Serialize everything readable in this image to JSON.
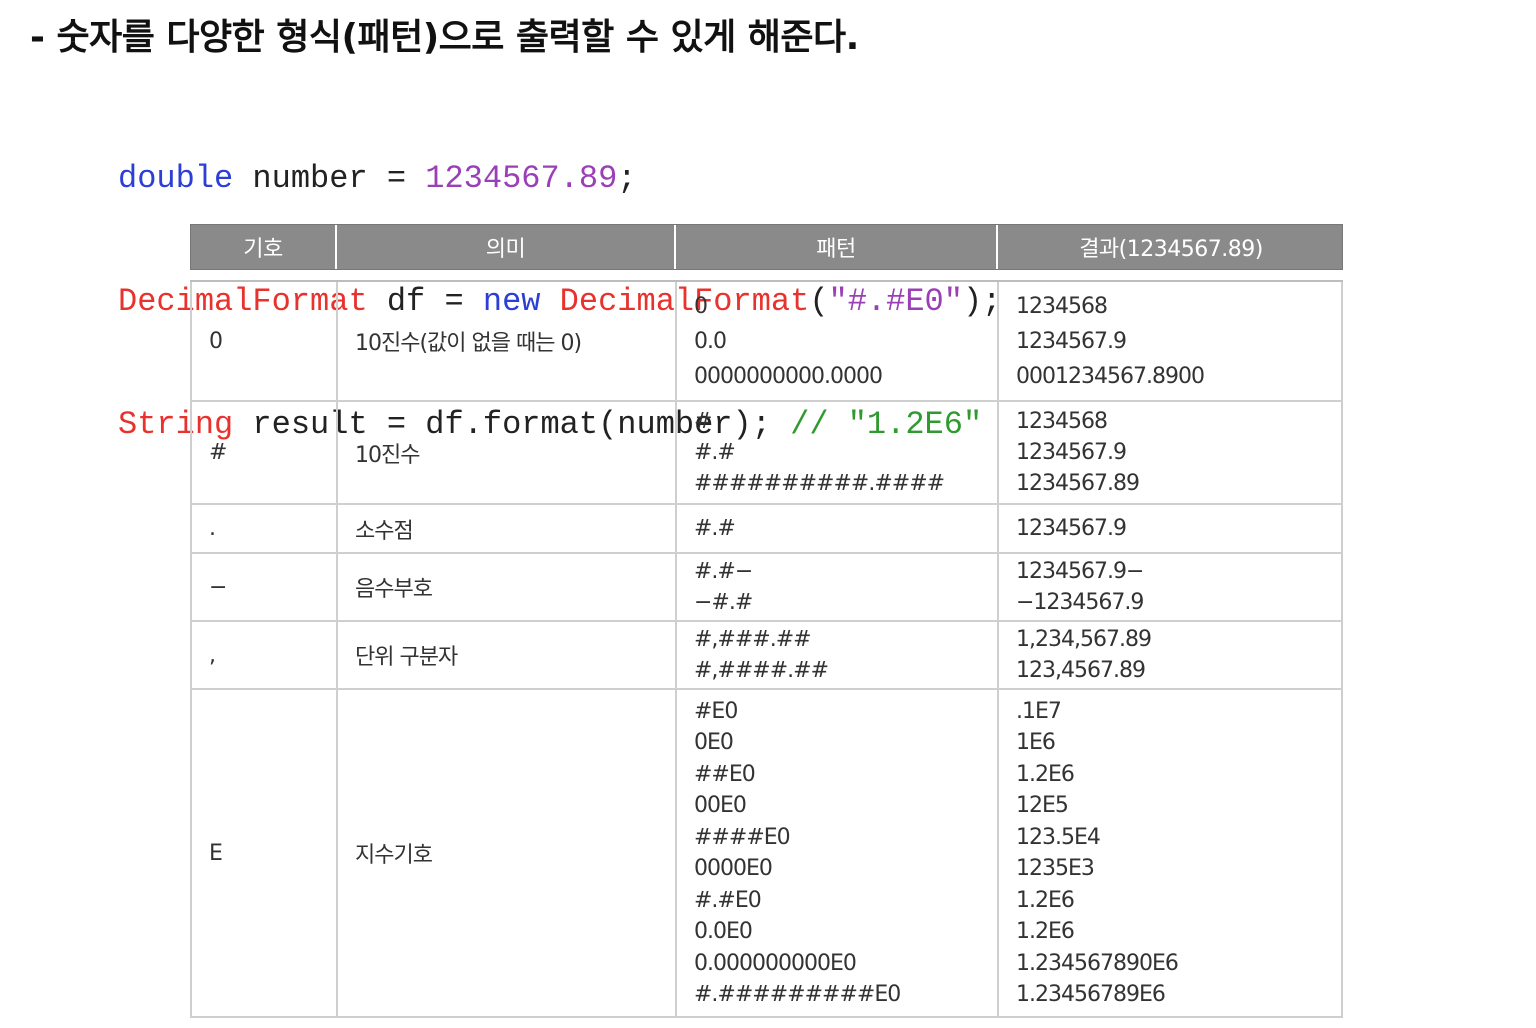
{
  "heading": "- 숫자를 다양한 형식(패턴)으로 출력할 수 있게 해준다.",
  "code": {
    "line1": {
      "type": "double",
      "rest": " number = ",
      "value": "1234567.89",
      "end": ";"
    },
    "line2": {
      "cls": "DecimalFormat",
      "mid": " df = ",
      "kw": "new",
      "ctor": " DecimalFormat",
      "open": "(",
      "arg": "\"#.#E0\"",
      "close": ");"
    },
    "line3": {
      "type": "String",
      "rest": " result = df.format(number); ",
      "comment": "// ",
      "cmt_str": "\"1.2E6\""
    }
  },
  "table": {
    "headers": [
      "기호",
      "의미",
      "패턴",
      "결과(1234567.89)"
    ],
    "rows": [
      {
        "symbol": "0",
        "meaning": "10진수(값이 없을 때는 0)",
        "patterns": [
          "0",
          "0.0",
          "0000000000.0000"
        ],
        "results": [
          "1234568",
          "1234567.9",
          "0001234567.8900"
        ]
      },
      {
        "symbol": "#",
        "meaning": "10진수",
        "patterns": [
          "#",
          "#.#",
          "##########.####"
        ],
        "results": [
          "1234568",
          "1234567.9",
          "1234567.89"
        ]
      },
      {
        "symbol": ".",
        "meaning": "소수점",
        "patterns": [
          "#.#"
        ],
        "results": [
          "1234567.9"
        ]
      },
      {
        "symbol": "−",
        "meaning": "음수부호",
        "patterns": [
          "#.#−",
          "−#.#"
        ],
        "results": [
          "1234567.9−",
          "−1234567.9"
        ]
      },
      {
        "symbol": ",",
        "meaning": "단위 구분자",
        "patterns": [
          "#,###.##",
          "#,####.##"
        ],
        "results": [
          "1,234,567.89",
          "123,4567.89"
        ]
      },
      {
        "symbol": "E",
        "meaning": "지수기호",
        "patterns": [
          "#E0",
          "0E0",
          "##E0",
          "00E0",
          "####E0",
          "0000E0",
          "#.#E0",
          "0.0E0",
          "0.000000000E0",
          "#.#########E0"
        ],
        "results": [
          ".1E7",
          "1E6",
          "1.2E6",
          "12E5",
          "123.5E4",
          "1235E3",
          "1.2E6",
          "1.2E6",
          "1.234567890E6",
          "1.23456789E6"
        ]
      }
    ]
  }
}
